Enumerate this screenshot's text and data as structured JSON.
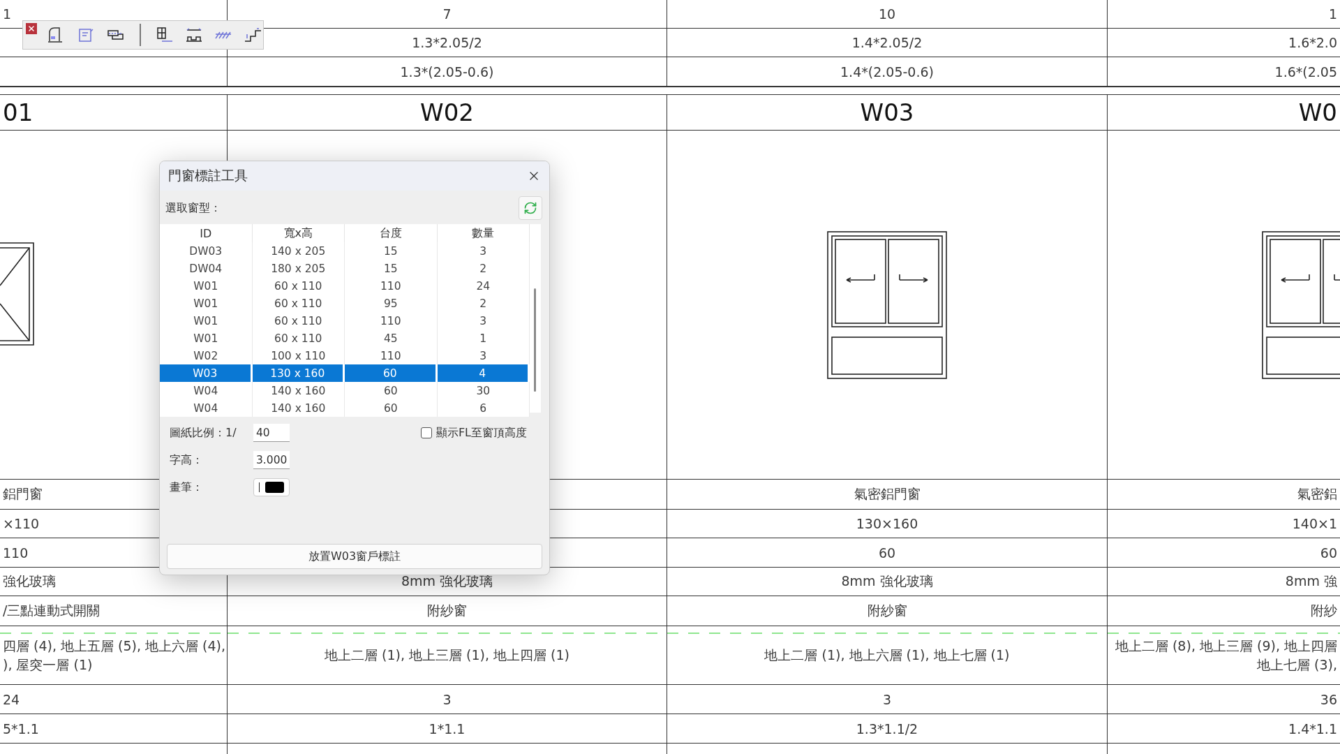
{
  "schedule": {
    "top_rows": [
      [
        "1",
        "7",
        "10",
        "1"
      ],
      [
        null,
        "1.3*2.05/2",
        "1.4*2.05/2",
        "1.6*2.0"
      ],
      [
        null,
        "1.3*(2.05-0.6)",
        "1.4*(2.05-0.6)",
        "1.6*(2.05"
      ]
    ],
    "ids": [
      "01",
      "W02",
      "W03",
      "W0"
    ],
    "detail_rows": [
      [
        [
          "鋁門窗"
        ],
        null,
        [
          "氣密鋁門窗"
        ],
        [
          "氣密鋁"
        ]
      ],
      [
        [
          "×110"
        ],
        null,
        [
          "130×160"
        ],
        [
          "140×1"
        ]
      ],
      [
        [
          "110"
        ],
        null,
        [
          "60"
        ],
        [
          "60"
        ]
      ],
      [
        [
          "強化玻璃"
        ],
        [
          "8mm 強化玻璃"
        ],
        [
          "8mm 強化玻璃"
        ],
        [
          "8mm 強"
        ]
      ],
      [
        [
          "/三點連動式開關"
        ],
        [
          "附紗窗"
        ],
        [
          "附紗窗"
        ],
        [
          "附紗"
        ]
      ],
      [
        [
          "四層 (4), 地上五層 (5), 地上六層 (4),",
          "), 屋突一層 (1)"
        ],
        [
          "地上二層 (1), 地上三層 (1), 地上四層 (1)"
        ],
        [
          "地上二層 (1), 地上六層 (1), 地上七層 (1)"
        ],
        [
          "地上二層 (8), 地上三層 (9), 地上四層",
          "地上七層 (3),"
        ]
      ],
      [
        [
          "24"
        ],
        [
          "3"
        ],
        [
          "3"
        ],
        [
          "36"
        ]
      ],
      [
        [
          "5*1.1"
        ],
        [
          "1*1.1"
        ],
        [
          "1.3*1.1/2"
        ],
        [
          "1.4*1.1"
        ]
      ]
    ]
  },
  "dialog": {
    "title": "門窗標註工具",
    "pick_label": "選取窗型：",
    "columns": [
      "ID",
      "寬x高",
      "台度",
      "數量"
    ],
    "rows": [
      {
        "id": "DW03",
        "size": "140 x 205",
        "sill": "15",
        "qty": "3",
        "selected": false
      },
      {
        "id": "DW04",
        "size": "180 x 205",
        "sill": "15",
        "qty": "2",
        "selected": false
      },
      {
        "id": "W01",
        "size": "60 x 110",
        "sill": "110",
        "qty": "24",
        "selected": false
      },
      {
        "id": "W01",
        "size": "60 x 110",
        "sill": "95",
        "qty": "2",
        "selected": false
      },
      {
        "id": "W01",
        "size": "60 x 110",
        "sill": "110",
        "qty": "3",
        "selected": false
      },
      {
        "id": "W01",
        "size": "60 x 110",
        "sill": "45",
        "qty": "1",
        "selected": false
      },
      {
        "id": "W02",
        "size": "100 x 110",
        "sill": "110",
        "qty": "3",
        "selected": false
      },
      {
        "id": "W03",
        "size": "130 x 160",
        "sill": "60",
        "qty": "4",
        "selected": true
      },
      {
        "id": "W04",
        "size": "140 x 160",
        "sill": "60",
        "qty": "30",
        "selected": false
      },
      {
        "id": "W04",
        "size": "140 x 160",
        "sill": "60",
        "qty": "6",
        "selected": false
      }
    ],
    "scale_label": "圖紙比例：1/",
    "scale_value": "40",
    "show_fl": {
      "label": "顯示FL至窗頂高度",
      "checked": false
    },
    "text_height_label": "字高：",
    "text_height_value": "3.000",
    "pen_label": "畫筆：",
    "place_button": "放置W03窗戶標註"
  }
}
